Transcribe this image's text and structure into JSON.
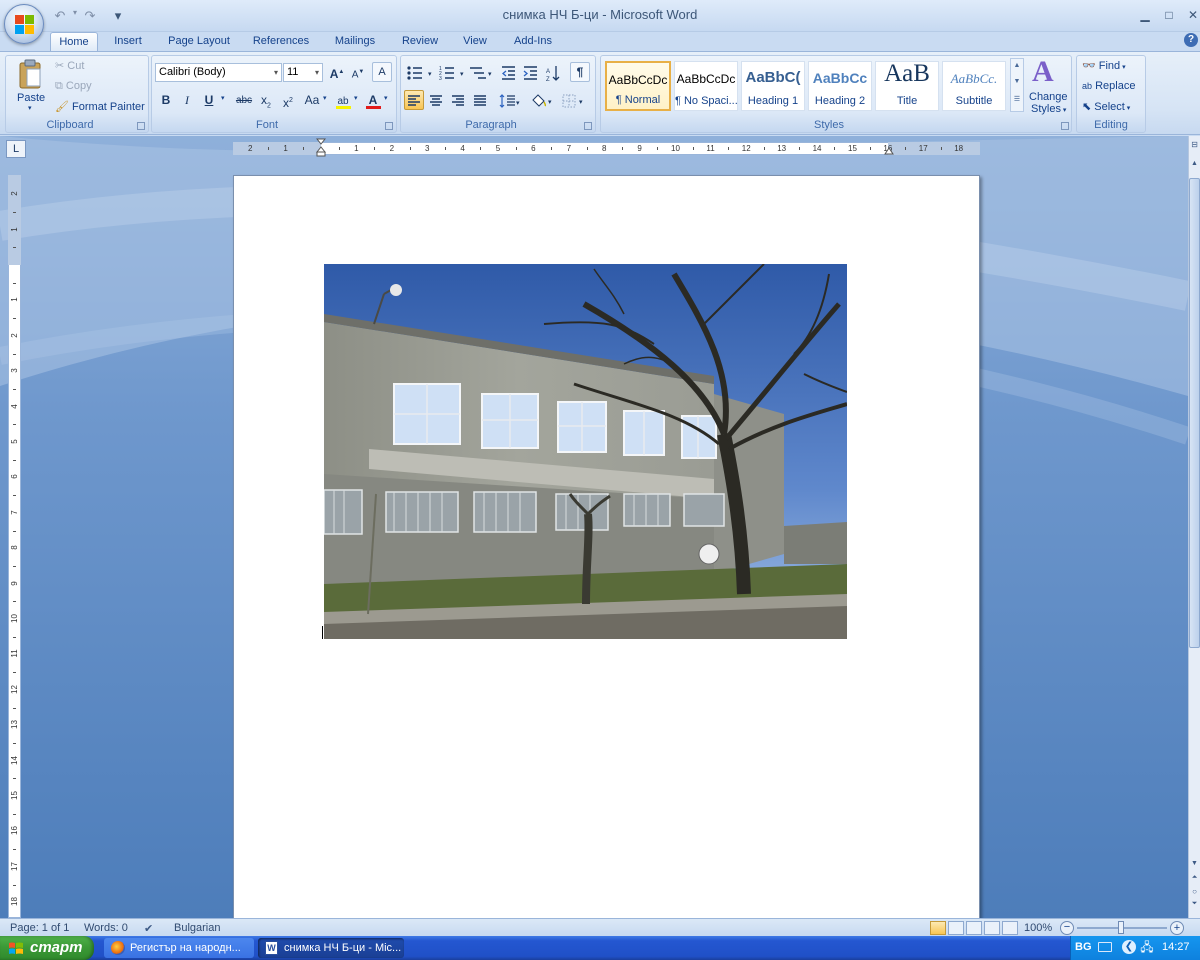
{
  "window": {
    "title": "снимка НЧ Б-ци - Microsoft Word",
    "controls": {
      "minimize": "▁",
      "maximize": "□",
      "close": "✕"
    }
  },
  "quick_access": {
    "undo": "↶",
    "redo": "↷",
    "customize": "▾"
  },
  "tabs": [
    "Home",
    "Insert",
    "Page Layout",
    "References",
    "Mailings",
    "Review",
    "View",
    "Add-Ins"
  ],
  "active_tab": "Home",
  "help_icon": "?",
  "clipboard": {
    "paste": "Paste",
    "cut": "Cut",
    "copy": "Copy",
    "format_painter": "Format Painter",
    "label": "Clipboard"
  },
  "font": {
    "name": "Calibri (Body)",
    "size": "11",
    "grow": "A",
    "shrink": "A",
    "clear": "A",
    "bold": "B",
    "italic": "I",
    "underline": "U",
    "strike": "abc",
    "subscript": "x",
    "superscript": "x",
    "change_case": "Aa",
    "highlight": "ab",
    "font_color": "A",
    "label": "Font"
  },
  "paragraph": {
    "show_marks": "¶",
    "label": "Paragraph"
  },
  "styles": {
    "tiles": [
      {
        "sample": "AaBbCcDc",
        "name": "¶ Normal",
        "selected": true
      },
      {
        "sample": "AaBbCcDc",
        "name": "¶ No Spaci...",
        "selected": false
      },
      {
        "sample": "AaBbC(",
        "name": "Heading 1",
        "selected": false
      },
      {
        "sample": "AaBbCc",
        "name": "Heading 2",
        "selected": false
      },
      {
        "sample": "AaB",
        "name": "Title",
        "selected": false
      },
      {
        "sample": "AaBbCc.",
        "name": "Subtitle",
        "selected": false
      }
    ],
    "change_styles_line1": "Change",
    "change_styles_line2": "Styles",
    "label": "Styles"
  },
  "editing": {
    "find": "Find",
    "replace": "Replace",
    "select": "Select",
    "label": "Editing"
  },
  "ruler_numbers_h": [
    "2",
    "1",
    "1",
    "2",
    "3",
    "4",
    "5",
    "6",
    "7",
    "8",
    "9",
    "10",
    "11",
    "12",
    "13",
    "14",
    "15",
    "16",
    "17",
    "18"
  ],
  "ruler_numbers_v": [
    "2",
    "1",
    "1",
    "2",
    "3",
    "4",
    "5",
    "6",
    "7",
    "8",
    "9",
    "10",
    "11",
    "12",
    "13",
    "14",
    "15",
    "16",
    "17",
    "18"
  ],
  "status": {
    "page": "Page: 1 of 1",
    "words": "Words: 0",
    "language": "Bulgarian",
    "zoom": "100%"
  },
  "taskbar": {
    "start": "старт",
    "tasks": [
      {
        "label": "Регистър на народн...",
        "active": false
      },
      {
        "label": "снимка НЧ Б-ци - Mic...",
        "active": true
      }
    ],
    "lang": "BG",
    "clock": "14:27"
  }
}
